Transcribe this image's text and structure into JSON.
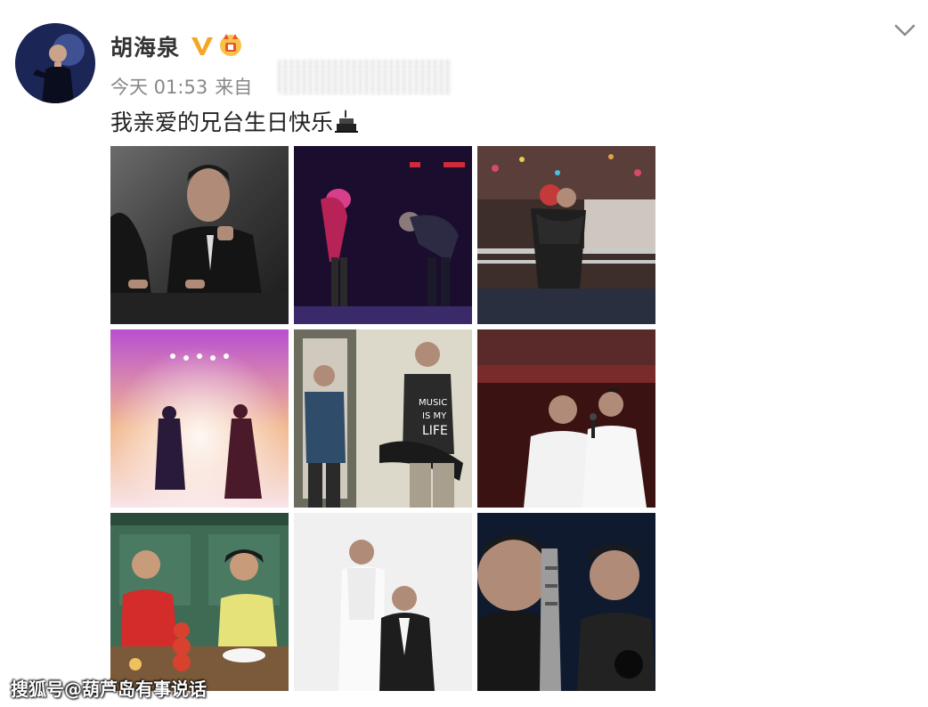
{
  "post": {
    "author": {
      "name": "胡海泉",
      "avatar_icon": "avatar-singer-photo",
      "verified_icon": "verified-v-icon",
      "badge_icon": "fan-badge-icon"
    },
    "timestamp": "今天 01:53",
    "source_prefix": "来自",
    "text": "我亲爱的兄台生日快乐",
    "text_emoji": "cake-icon",
    "menu_icon": "chevron-down-icon"
  },
  "photos": [
    {
      "name": "photo-1",
      "description_icon": "man-in-suit-photo"
    },
    {
      "name": "photo-2",
      "description_icon": "two-men-bowing-stage-photo"
    },
    {
      "name": "photo-3",
      "description_icon": "two-men-hugging-concert-photo"
    },
    {
      "name": "photo-4",
      "description_icon": "stage-lights-silhouettes-photo"
    },
    {
      "name": "photo-5",
      "description_icon": "two-men-skateboard-photo"
    },
    {
      "name": "photo-6",
      "description_icon": "two-men-singing-photo"
    },
    {
      "name": "photo-7",
      "description_icon": "two-men-eating-photo"
    },
    {
      "name": "photo-8",
      "description_icon": "two-men-studio-photo"
    },
    {
      "name": "photo-9",
      "description_icon": "two-men-guitar-photo"
    }
  ],
  "watermark": "搜狐号@葫芦岛有事说话",
  "colors": {
    "verified_orange": "#f5a623",
    "badge_red": "#e8542f",
    "meta_gray": "#888888"
  }
}
